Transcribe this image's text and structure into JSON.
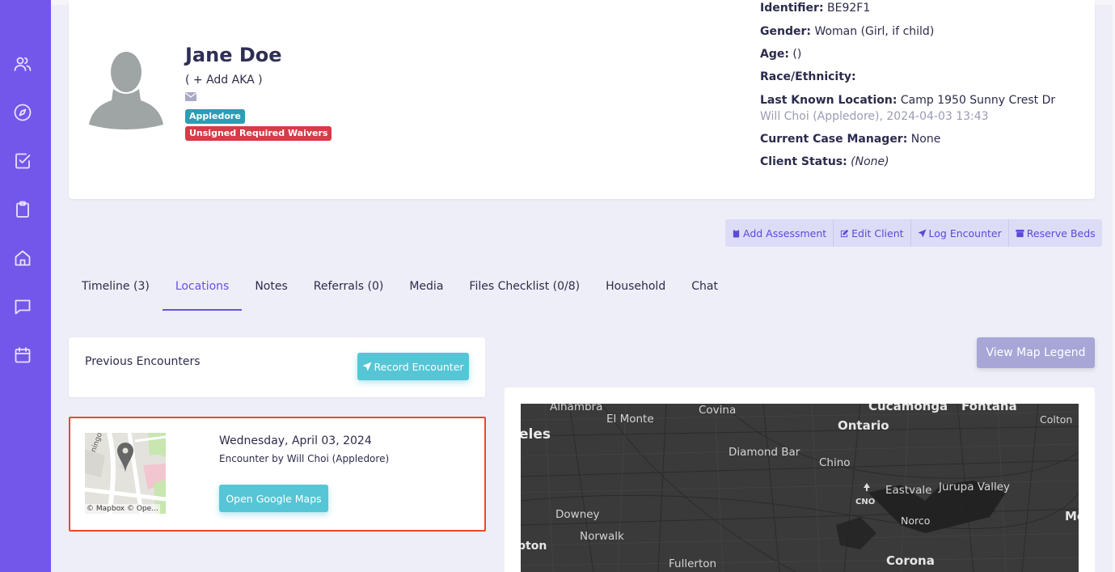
{
  "client": {
    "name": "Jane Doe",
    "add_aka": "( + Add AKA )",
    "badges": [
      "Appledore",
      "Unsigned Required Waivers"
    ]
  },
  "info": {
    "identifier_label": "Identifier:",
    "identifier_value": "BE92F1",
    "gender_label": "Gender:",
    "gender_value": "Woman (Girl, if child)",
    "age_label": "Age:",
    "age_value": "()",
    "race_label": "Race/Ethnicity:",
    "location_label": "Last Known Location:",
    "location_value": "Camp 1950 Sunny Crest Dr",
    "location_sub": "Will Choi (Appledore), 2024-04-03 13:43",
    "case_manager_label": "Current Case Manager:",
    "case_manager_value": "None",
    "status_label": "Client Status:",
    "status_value": "(None)"
  },
  "actions": [
    "Add Assessment",
    "Edit Client",
    "Log Encounter",
    "Reserve Beds"
  ],
  "tabs": [
    "Timeline (3)",
    "Locations",
    "Notes",
    "Referrals (0)",
    "Media",
    "Files Checklist (0/8)",
    "Household",
    "Chat"
  ],
  "active_tab": "Locations",
  "encounters": {
    "title": "Previous Encounters",
    "record_button": "Record Encounter",
    "item": {
      "date": "Wednesday, April 03, 2024",
      "by": "Encounter by Will Choi (Appledore)",
      "button": "Open Google Maps",
      "thumb_credit": "© Mapbox © Ope...",
      "thumb_road": "ningo Rd"
    }
  },
  "map": {
    "legend_button": "View Map Legend",
    "labels": [
      "Alhambra",
      "El Monte",
      "Covina",
      "Cucamonga",
      "Fontana",
      "Colton",
      "eles",
      "Ontario",
      "Diamond Bar",
      "Chino",
      "Eastvale",
      "Jurupa Valley",
      "CNO",
      "Downey",
      "Norco",
      "Mo",
      "Norwalk",
      "pton",
      "Fullerton",
      "Corona"
    ]
  },
  "colors": {
    "sidebar": "#7357ea",
    "accent": "#6a4fe0",
    "teal": "#56c6d6",
    "badge_teal": "#2c9db5",
    "badge_red": "#d63b47",
    "highlight": "#e8482c"
  }
}
